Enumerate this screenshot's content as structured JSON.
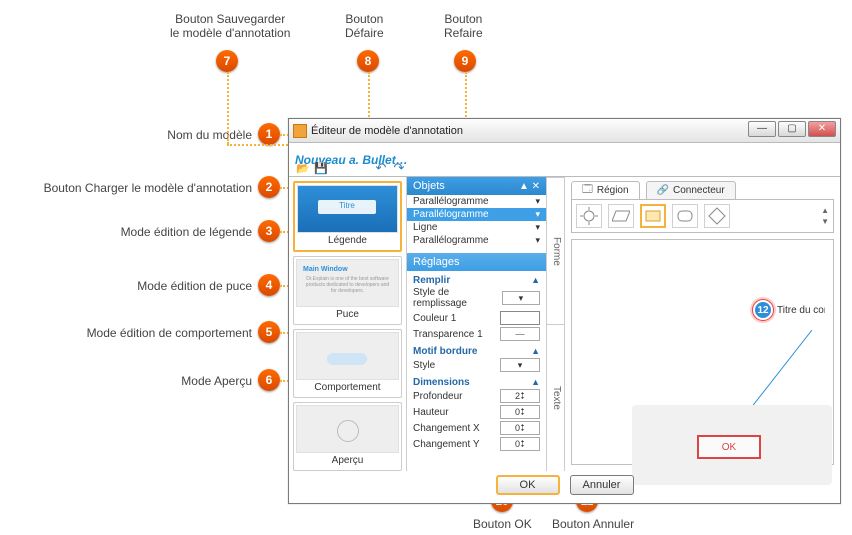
{
  "dialog": {
    "title": "Éditeur de modèle d'annotation",
    "model_name": "Nouveau a. Bullet + Fra..."
  },
  "toolbar": {
    "load_icon": "folder-open-icon",
    "save_icon": "save-icon",
    "undo_icon": "undo-icon",
    "redo_icon": "redo-icon"
  },
  "thumbs": [
    {
      "num": "1",
      "caption": "Légende",
      "id": "legend"
    },
    {
      "num": "2",
      "caption": "Puce",
      "id": "bullet"
    },
    {
      "num": "3",
      "caption": "Comportement",
      "id": "behavior"
    },
    {
      "num": "4",
      "caption": "Aperçu",
      "id": "preview"
    }
  ],
  "objects": {
    "panel_title": "Objets",
    "items": [
      {
        "label": "Parallélogramme",
        "selected": false
      },
      {
        "label": "Parallélogramme",
        "selected": true
      },
      {
        "label": "Ligne",
        "selected": false
      },
      {
        "label": "Parallélogramme",
        "selected": false
      }
    ]
  },
  "settings": {
    "panel_title": "Réglages",
    "sections": [
      {
        "title": "Remplir",
        "props": [
          {
            "label": "Style de remplissage",
            "ctrl": "dropdown"
          },
          {
            "label": "Couleur 1",
            "ctrl": "color"
          },
          {
            "label": "Transparence 1",
            "ctrl": "slider"
          }
        ]
      },
      {
        "title": "Motif bordure",
        "props": [
          {
            "label": "Style",
            "ctrl": "dropdown"
          }
        ]
      },
      {
        "title": "Dimensions",
        "props": [
          {
            "label": "Profondeur",
            "value": "2"
          },
          {
            "label": "Hauteur",
            "value": "0"
          },
          {
            "label": "Changement X",
            "value": "0"
          },
          {
            "label": "Changement Y",
            "value": "0"
          }
        ]
      }
    ]
  },
  "side_tabs": [
    "Forme",
    "Texte"
  ],
  "canvas_tabs": {
    "region": "Région",
    "connector": "Connecteur"
  },
  "canvas": {
    "badge_number": "12",
    "badge_text": "Titre du con",
    "ok_label": "OK"
  },
  "footer": {
    "ok": "OK",
    "cancel": "Annuler"
  },
  "callouts": {
    "c1": "Nom du modèle",
    "c2": "Bouton Charger le modèle d'annotation",
    "c3": "Mode édition de légende",
    "c4": "Mode édition de puce",
    "c5": "Mode édition de comportement",
    "c6": "Mode Aperçu",
    "c7": "Bouton Sauvegarder\nle modèle d'annotation",
    "c8": "Bouton\nDéfaire",
    "c9": "Bouton\nRefaire",
    "c10": "Bouton OK",
    "c11": "Bouton Annuler"
  }
}
